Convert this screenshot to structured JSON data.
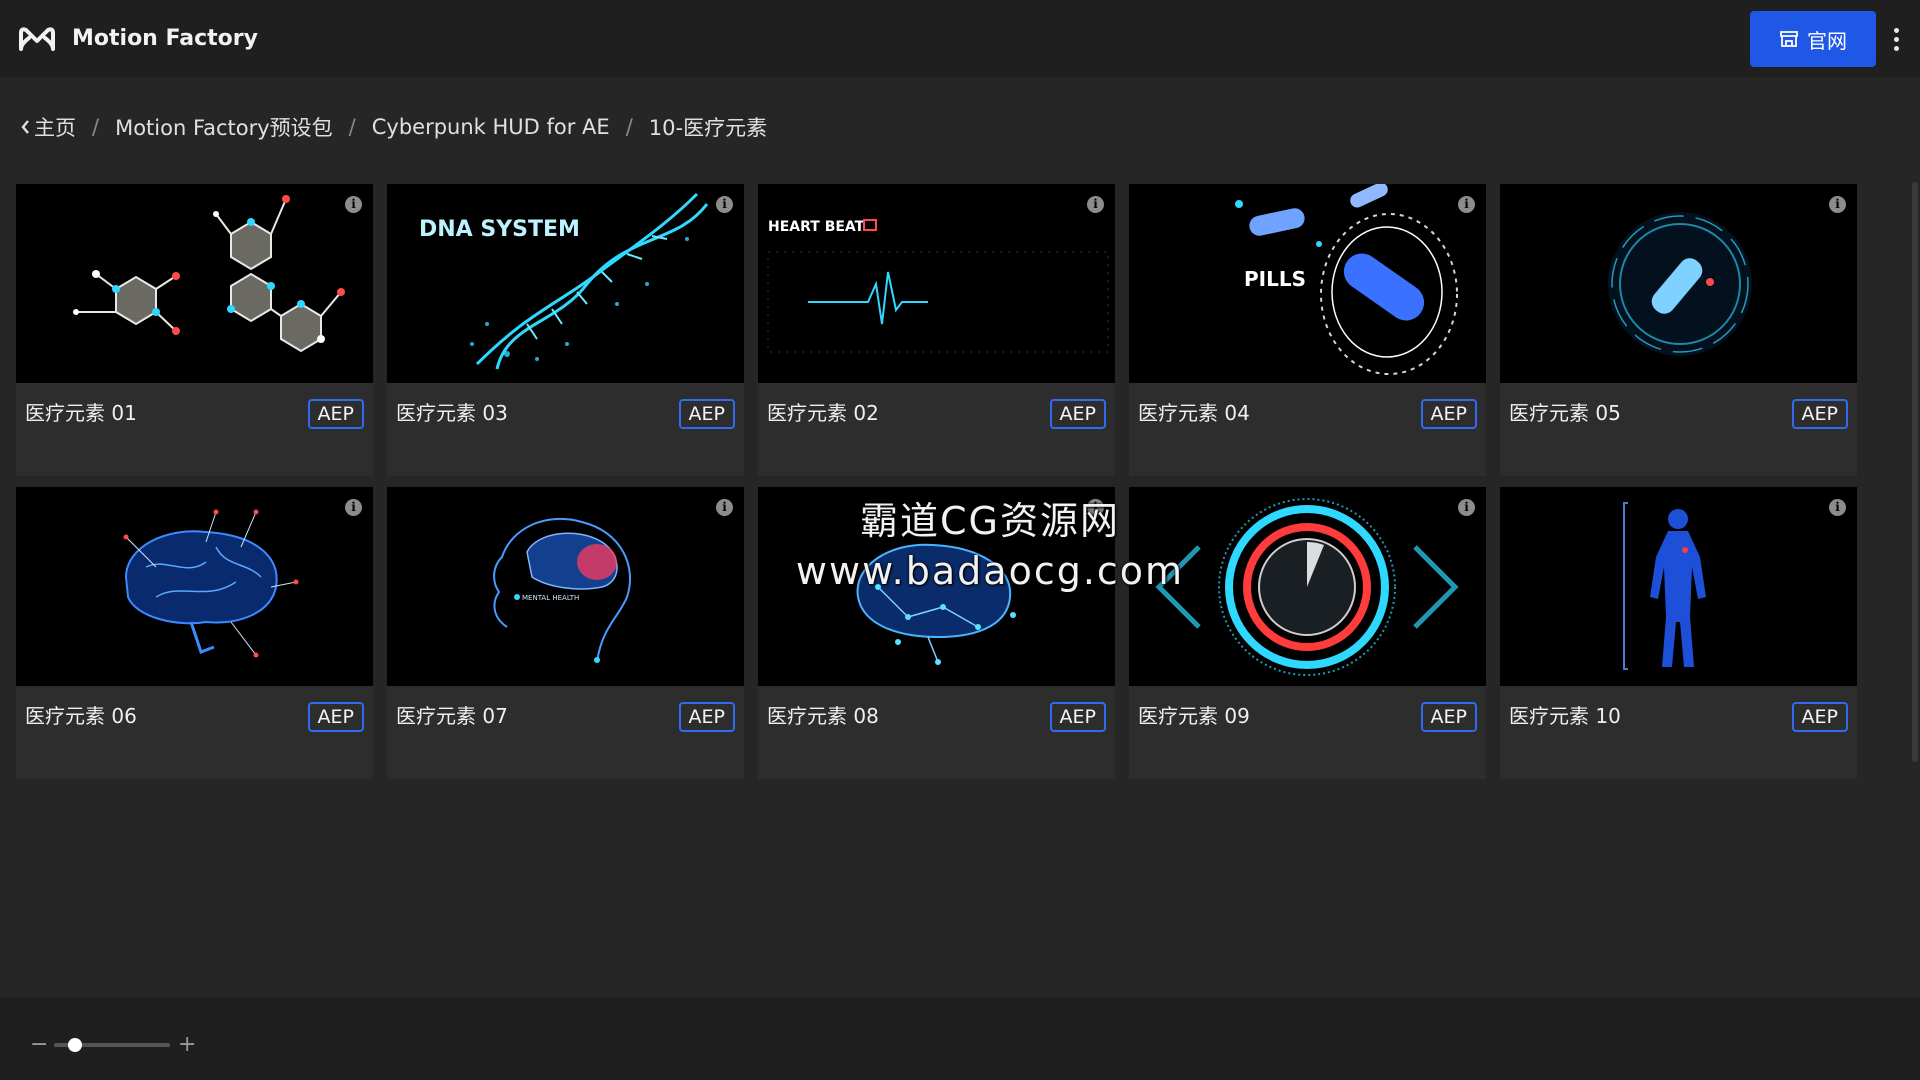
{
  "app": {
    "title": "Motion Factory",
    "site_button_label": "官网"
  },
  "breadcrumb": [
    {
      "label": "主页"
    },
    {
      "label": "Motion Factory预设包"
    },
    {
      "label": "Cyberpunk HUD for AE"
    },
    {
      "label": "10-医疗元素"
    }
  ],
  "cards": [
    {
      "title": "医疗元素 01",
      "badge": "AEP",
      "thumb_text": ""
    },
    {
      "title": "医疗元素 03",
      "badge": "AEP",
      "thumb_text": "DNA SYSTEM"
    },
    {
      "title": "医疗元素 02",
      "badge": "AEP",
      "thumb_text": "HEART BEAT"
    },
    {
      "title": "医疗元素 04",
      "badge": "AEP",
      "thumb_text": "PILLS"
    },
    {
      "title": "医疗元素 05",
      "badge": "AEP",
      "thumb_text": ""
    },
    {
      "title": "医疗元素 06",
      "badge": "AEP",
      "thumb_text": ""
    },
    {
      "title": "医疗元素 07",
      "badge": "AEP",
      "thumb_text": "MENTAL HEALTH"
    },
    {
      "title": "医疗元素 08",
      "badge": "AEP",
      "thumb_text": ""
    },
    {
      "title": "医疗元素 09",
      "badge": "AEP",
      "thumb_text": ""
    },
    {
      "title": "医疗元素 10",
      "badge": "AEP",
      "thumb_text": ""
    }
  ],
  "watermark": {
    "line1": "霸道CG资源网",
    "line2": "www.badaocg.com"
  },
  "zoom": {
    "minus": "−",
    "plus": "+",
    "level": 0.18
  },
  "icons": {
    "logo": "motion-factory-logo-icon",
    "site": "store-icon",
    "more": "more-vertical-icon",
    "back": "chevron-left-icon",
    "info": "info-icon"
  },
  "colors": {
    "accent": "#1f57e6",
    "badge_border": "#2f6cf2",
    "glow": "#2fd8ff"
  }
}
